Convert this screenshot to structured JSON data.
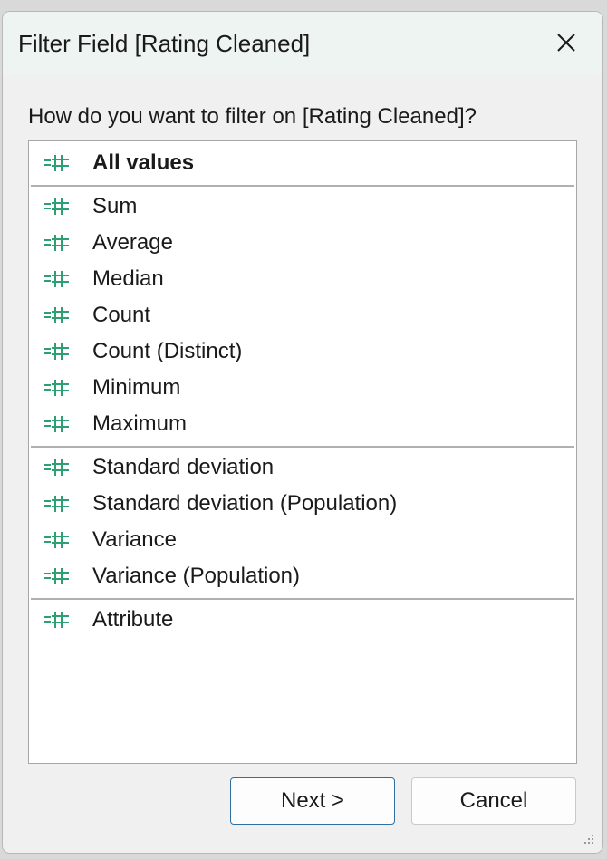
{
  "window": {
    "title": "Filter Field [Rating Cleaned]"
  },
  "prompt": "How do you want to filter on [Rating Cleaned]?",
  "icon_name": "measure-hash-icon",
  "icon_color": "#2e9e73",
  "list": {
    "groups": [
      {
        "items": [
          {
            "label": "All values",
            "bold": true
          }
        ]
      },
      {
        "items": [
          {
            "label": "Sum"
          },
          {
            "label": "Average"
          },
          {
            "label": "Median"
          },
          {
            "label": "Count"
          },
          {
            "label": "Count (Distinct)"
          },
          {
            "label": "Minimum"
          },
          {
            "label": "Maximum"
          }
        ]
      },
      {
        "items": [
          {
            "label": "Standard deviation"
          },
          {
            "label": "Standard deviation (Population)"
          },
          {
            "label": "Variance"
          },
          {
            "label": "Variance (Population)"
          }
        ]
      },
      {
        "items": [
          {
            "label": "Attribute"
          }
        ]
      }
    ]
  },
  "buttons": {
    "next_label": "Next >",
    "cancel_label": "Cancel"
  }
}
